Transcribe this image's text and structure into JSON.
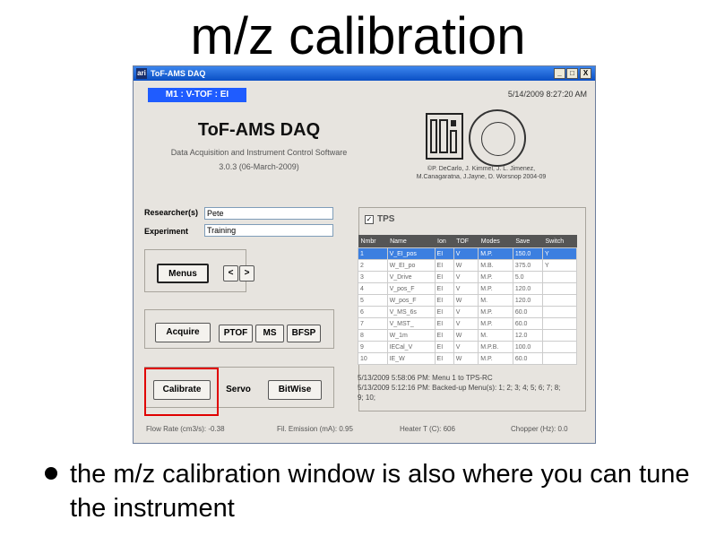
{
  "slide": {
    "title": "m/z calibration",
    "bullet": "the m/z calibration window is also where you can tune the instrument"
  },
  "window": {
    "title": "ToF-AMS DAQ",
    "icon_text": "ari",
    "controls": {
      "minimize": "_",
      "maximize": "□",
      "close": "X"
    }
  },
  "header": {
    "mode": "M1 : V-TOF : EI",
    "datetime": "5/14/2009 8:27:20 AM",
    "app_name": "ToF-AMS DAQ",
    "subtitle": "Data Acquisition and Instrument Control Software",
    "version": "3.0.3 (06-March-2009)",
    "credits_line1": "©P. DeCarlo, J. Kimmel, J. L. Jimenez,",
    "credits_line2": "M.Canagaratna, J.Jayne, D. Worsnop 2004-09"
  },
  "form": {
    "researcher_label": "Researcher(s)",
    "researcher_value": "Pete",
    "experiment_label": "Experiment",
    "experiment_value": "Training"
  },
  "buttons": {
    "menus": "Menus",
    "prev": "<",
    "next": ">",
    "acquire": "Acquire",
    "ptof": "PTOF",
    "ms": "MS",
    "bfsp": "BFSP",
    "calibrate": "Calibrate",
    "servo": "Servo",
    "bitwise": "BitWise"
  },
  "tps": {
    "label": "TPS",
    "checked": "✓",
    "columns": [
      "Nmbr",
      "Name",
      "Ion",
      "TOF",
      "Modes",
      "Save",
      "Switch"
    ],
    "rows": [
      [
        "1",
        "V_EI_pos",
        "EI",
        "V",
        "M.P.",
        "150.0",
        "Y"
      ],
      [
        "2",
        "W_EI_po",
        "EI",
        "W",
        "M.B.",
        "375.0",
        "Y"
      ],
      [
        "3",
        "V_Drive",
        "EI",
        "V",
        "M.P.",
        "5.0",
        ""
      ],
      [
        "4",
        "V_pos_F",
        "EI",
        "V",
        "M.P.",
        "120.0",
        ""
      ],
      [
        "5",
        "W_pos_F",
        "EI",
        "W",
        "M.",
        "120.0",
        ""
      ],
      [
        "6",
        "V_MS_6s",
        "EI",
        "V",
        "M.P.",
        "60.0",
        ""
      ],
      [
        "7",
        "V_MST_",
        "EI",
        "V",
        "M.P.",
        "60.0",
        ""
      ],
      [
        "8",
        "W_1m",
        "EI",
        "W",
        "M.",
        "12.0",
        ""
      ],
      [
        "9",
        "IECal_V",
        "EI",
        "V",
        "M.P.B.",
        "100.0",
        ""
      ],
      [
        "10",
        "IE_W",
        "EI",
        "W",
        "M.P.",
        "60.0",
        ""
      ]
    ],
    "log_line1": "5/13/2009 5:58:06 PM:  Menu 1 to TPS-RC",
    "log_line2": "5/13/2009 5:12:16 PM:  Backed-up Menu(s): 1; 2; 3; 4; 5; 6; 7; 8;",
    "log_line3": "9; 10;"
  },
  "status": {
    "flow_rate": "Flow Rate (cm3/s): -0.38",
    "fil_emission": "Fil. Emission (mA): 0.95",
    "heater": "Heater T (C): 606",
    "chopper": "Chopper (Hz): 0.0"
  },
  "colors": {
    "titlebar": "#0a4fc4",
    "mode_badge": "#1f5cff",
    "table_header": "#555555",
    "selected_row": "#3c7fe0",
    "highlight_box": "#e00000"
  }
}
